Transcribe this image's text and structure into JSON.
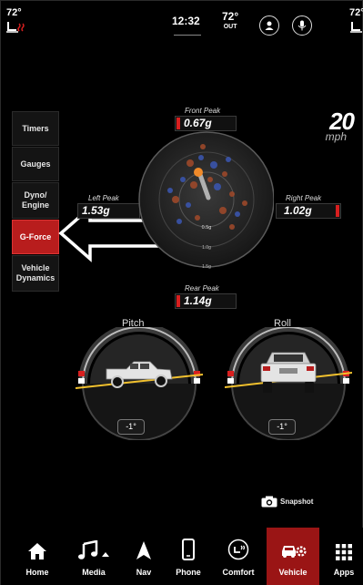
{
  "status": {
    "left_temp": "72°",
    "clock": "12:32",
    "outside_temp": "72°",
    "outside_label": "OUT",
    "right_temp": "72°"
  },
  "menu": {
    "items": [
      {
        "label": "Timers"
      },
      {
        "label": "Gauges"
      },
      {
        "label": "Dyno/ Engine"
      },
      {
        "label": "G-Force"
      },
      {
        "label": "Vehicle Dynamics"
      }
    ],
    "selected": "G-Force"
  },
  "speed": {
    "value": "20",
    "unit": "mph"
  },
  "gforce": {
    "front_label": "Front Peak",
    "front_value": "0.67g",
    "left_label": "Left Peak",
    "left_value": "1.53g",
    "right_label": "Right Peak",
    "right_value": "1.02g",
    "rear_label": "Rear Peak",
    "rear_value": "1.14g",
    "ring_label_inner": "0.5g",
    "ring_label_mid": "1.0g",
    "ring_label_outer": "1.5g"
  },
  "pitch": {
    "title": "Pitch",
    "angle": "-1°"
  },
  "roll": {
    "title": "Roll",
    "angle": "-1°"
  },
  "snapshot_label": "Snapshot",
  "nav": {
    "items": [
      {
        "label": "Home",
        "icon": "home-icon"
      },
      {
        "label": "Media",
        "icon": "music-icon"
      },
      {
        "label": "Nav",
        "icon": "navigation-arrow-icon"
      },
      {
        "label": "Phone",
        "icon": "phone-icon"
      },
      {
        "label": "Comfort",
        "icon": "comfort-icon"
      },
      {
        "label": "Vehicle",
        "icon": "vehicle-icon"
      },
      {
        "label": "Apps",
        "icon": "apps-grid-icon"
      }
    ],
    "active": "Vehicle"
  },
  "colors": {
    "accent_red": "#b81d1d",
    "peak_bar_red": "#d81f1f",
    "horizon_yellow": "#f2c12e"
  }
}
